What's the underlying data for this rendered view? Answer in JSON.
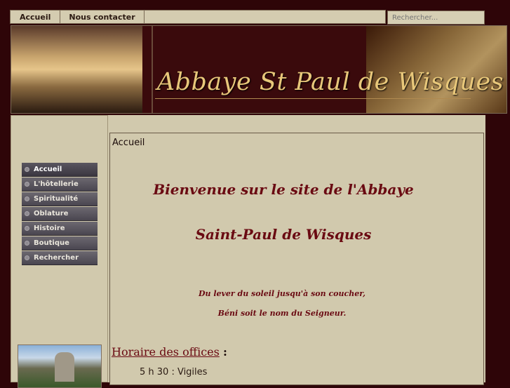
{
  "topnav": {
    "items": [
      "Accueil",
      "Nous contacter"
    ]
  },
  "search": {
    "placeholder": "Rechercher..."
  },
  "banner": {
    "title": "Abbaye St Paul de Wisques"
  },
  "sidebar": {
    "items": [
      {
        "label": "Accueil",
        "active": true
      },
      {
        "label": "L'hôtellerie"
      },
      {
        "label": "Spiritualité"
      },
      {
        "label": "Oblature"
      },
      {
        "label": "Histoire"
      },
      {
        "label": "Boutique"
      },
      {
        "label": "Rechercher"
      }
    ]
  },
  "main": {
    "breadcrumb": "Accueil",
    "welcome_line1": "Bienvenue sur le site de l'Abbaye",
    "welcome_line2": "Saint-Paul de Wisques",
    "quote_line1": "Du lever du soleil  jusqu'à son coucher,",
    "quote_line2": "Béni soit le nom du Seigneur.",
    "offices_title": "Horaire des offices",
    "offices_colon": ":",
    "offices_first": "5 h 30 : Vigiles"
  },
  "colors": {
    "background": "#2e0508",
    "panel": "#d1c9ad",
    "accent_text": "#6a0a12",
    "banner_title": "#e8c77a",
    "menu_bg": "#4a4650"
  }
}
